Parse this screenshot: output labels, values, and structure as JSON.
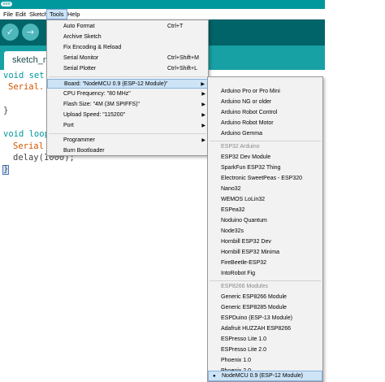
{
  "titlebar": {
    "app_mark": "ooo"
  },
  "menubar": {
    "items": [
      "File",
      "Edit",
      "Sketch",
      "Tools",
      "Help"
    ]
  },
  "toolbar": {
    "verify_icon": "check-icon",
    "upload_icon": "arrow-right-icon",
    "verify_glyph": "✓",
    "upload_glyph": "→"
  },
  "tab": {
    "label": "sketch_n"
  },
  "editor": {
    "line1a": "void set",
    "line2": "Serial.",
    "line3": "}",
    "line4": "void loop",
    "line5": "Serial",
    "line6": "delay(1000);",
    "line7": "}"
  },
  "tools_menu": {
    "items": [
      {
        "label": "Auto Format",
        "shortcut": "Ctrl+T"
      },
      {
        "label": "Archive Sketch",
        "shortcut": ""
      },
      {
        "label": "Fix Encoding & Reload",
        "shortcut": ""
      },
      {
        "label": "Serial Monitor",
        "shortcut": "Ctrl+Shift+M"
      },
      {
        "label": "Serial Plotter",
        "shortcut": "Ctrl+Shift+L"
      },
      {
        "label": "Board: \"NodeMCU 0.9 (ESP-12 Module)\"",
        "shortcut": ""
      },
      {
        "label": "CPU Frequency: \"80 MHz\"",
        "shortcut": ""
      },
      {
        "label": "Flash Size: \"4M (3M SPIFFS)\"",
        "shortcut": ""
      },
      {
        "label": "Upload Speed: \"115200\"",
        "shortcut": ""
      },
      {
        "label": "Port",
        "shortcut": ""
      },
      {
        "label": "Programmer",
        "shortcut": ""
      },
      {
        "label": "Burn Bootloader",
        "shortcut": ""
      }
    ],
    "submenu_arrow": "▶"
  },
  "boards_menu": {
    "items": [
      "Arduino Pro or Pro Mini",
      "Arduino NG or older",
      "Arduino Robot Control",
      "Arduino Robot Motor",
      "Arduino Gemma",
      "ESP32 Arduino",
      "ESP32 Dev Module",
      "SparkFun ESP32 Thing",
      "Electronic SweetPeas - ESP320",
      "Nano32",
      "WEMOS LoLin32",
      "ESPea32",
      "Noduino Quantum",
      "Node32s",
      "Hornbill ESP32 Dev",
      "Hornbill ESP32 Minima",
      "FireBeetle-ESP32",
      "IntoRobot Fig",
      "ESP8266 Modules",
      "Generic ESP8266 Module",
      "Generic ESP8285 Module",
      "ESPDuino (ESP-13 Module)",
      "Adafruit HUZZAH ESP8266",
      "ESPresso Lite 1.0",
      "ESPresso Lite 2.0",
      "Phoenix 1.0",
      "Phoenix 2.0",
      "NodeMCU 0.9 (ESP-12 Module)"
    ],
    "selected_bullet": "●"
  }
}
